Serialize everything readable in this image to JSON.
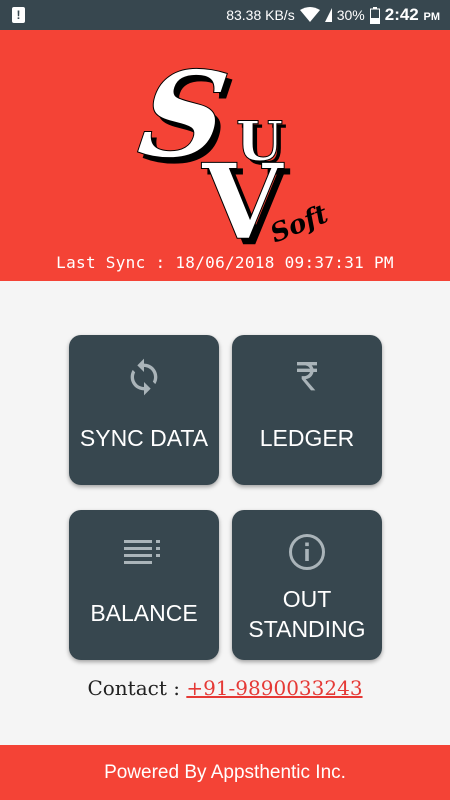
{
  "status_bar": {
    "speed": "83.38 KB/s",
    "battery": "30%",
    "time": "2:42",
    "ampm": "PM",
    "icons": [
      "alert-icon",
      "wifi-icon",
      "signal-icon",
      "battery-icon"
    ]
  },
  "header": {
    "logo_text": "SV",
    "logo_sub": "Soft",
    "last_sync": "Last Sync : 18/06/2018 09:37:31 PM"
  },
  "tiles": [
    {
      "label": "SYNC DATA",
      "icon": "sync-icon"
    },
    {
      "label": "LEDGER",
      "icon": "rupee-icon"
    },
    {
      "label": "BALANCE",
      "icon": "list-icon"
    },
    {
      "label_line1": "OUT",
      "label_line2": "STANDING",
      "icon": "info-icon"
    }
  ],
  "contact": {
    "label": "Contact : ",
    "phone": "+91-9890033243"
  },
  "footer": {
    "text": "Powered By Appsthentic Inc."
  },
  "colors": {
    "primary_red": "#f44336",
    "tile_dark": "#37474f",
    "status_bar": "#37474f",
    "link_red": "#e53935"
  }
}
